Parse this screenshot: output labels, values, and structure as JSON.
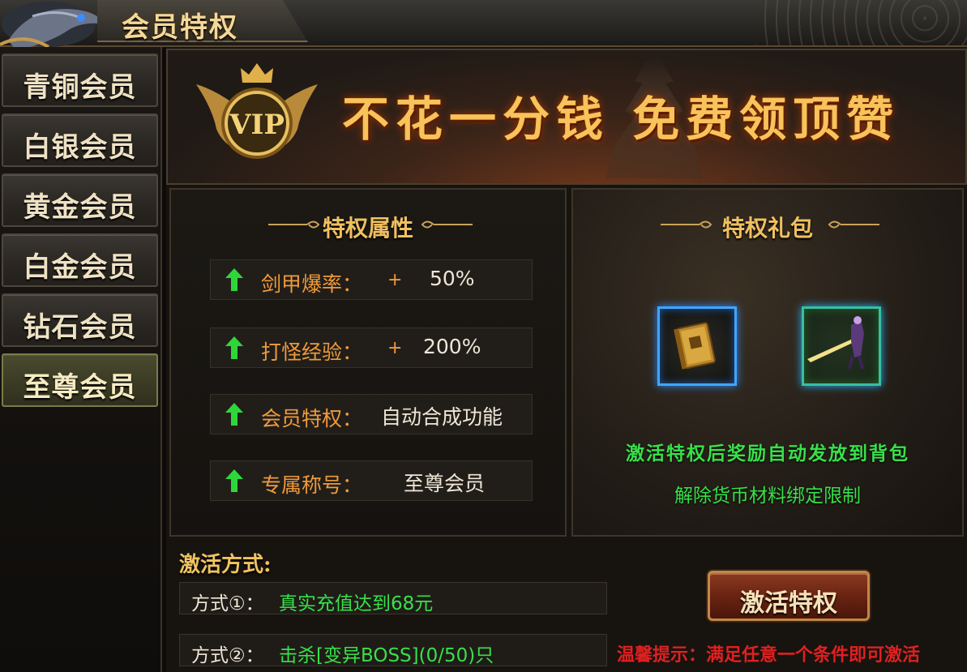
{
  "window": {
    "title": "会员特权"
  },
  "sidebar": {
    "items": [
      {
        "label": "青铜会员"
      },
      {
        "label": "白银会员"
      },
      {
        "label": "黄金会员"
      },
      {
        "label": "白金会员"
      },
      {
        "label": "钻石会员"
      },
      {
        "label": "至尊会员",
        "active": true
      }
    ]
  },
  "banner": {
    "badge_text": "VIP",
    "slogan": "不花一分钱 免费领顶赞"
  },
  "attributes": {
    "title": "特权属性",
    "rows": [
      {
        "name": "剑甲爆率：",
        "plus": "+",
        "value": "50%"
      },
      {
        "name": "打怪经验：",
        "plus": "+",
        "value": "200%"
      },
      {
        "name": "会员特权：",
        "value": "自动合成功能"
      },
      {
        "name": "专属称号：",
        "value": "至尊会员"
      }
    ]
  },
  "gift": {
    "title": "特权礼包",
    "items": [
      {
        "icon": "book-icon"
      },
      {
        "icon": "warrior-sword-icon"
      }
    ],
    "note1": "激活特权后奖励自动发放到背包",
    "note2": "解除货币材料绑定限制"
  },
  "activation": {
    "title": "激活方式:",
    "methods": [
      {
        "label": "方式①：",
        "condition": "真实充值达到68元"
      },
      {
        "label": "方式②：",
        "condition": "击杀[变异BOSS](0/50)只"
      }
    ],
    "button": "激活特权",
    "tip": "温馨提示：满足任意一个条件即可激活"
  },
  "colors": {
    "accent_gold": "#f0c060",
    "attr_orange": "#f09a3c",
    "green": "#38e04a",
    "tip_red": "#e02020"
  }
}
